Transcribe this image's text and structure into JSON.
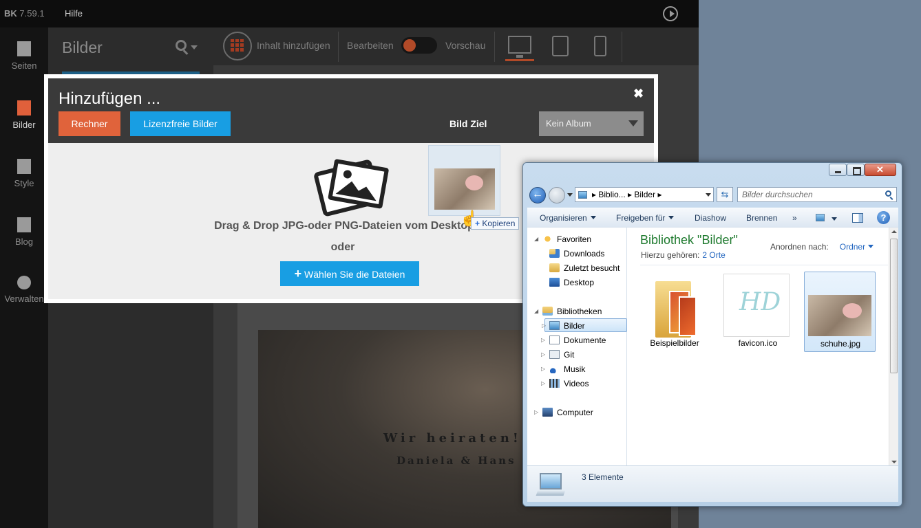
{
  "app": {
    "topbar": {
      "version_prefix": "BK",
      "version": "7.59.1",
      "help": "Hilfe"
    },
    "nav": [
      {
        "label": "Seiten"
      },
      {
        "label": "Bilder"
      },
      {
        "label": "Style"
      },
      {
        "label": "Blog"
      },
      {
        "label": "Verwalten"
      }
    ],
    "panel_title": "Bilder",
    "toolbar": {
      "add_content": "Inhalt hinzufügen",
      "edit": "Bearbeiten",
      "preview": "Vorschau"
    },
    "canvas_text": {
      "line1": "Wir heiraten!",
      "line2": "Daniela & Hans"
    }
  },
  "modal": {
    "title": "Hinzufügen ...",
    "close": "✖",
    "btn_calculator": "Rechner",
    "btn_stock": "Lizenzfreie Bilder",
    "dest_label": "Bild Ziel",
    "album_select": "Kein Album",
    "dropzone_text": "Drag & Drop JPG-oder PNG-Dateien vom Desktop",
    "or": "oder",
    "choose_plus": "+",
    "choose_label": "Wählen Sie die Dateien",
    "colors": {
      "orange": "#e0633b",
      "blue": "#189ee3"
    }
  },
  "drag": {
    "tip_plus": "+",
    "tip_label": "Kopieren"
  },
  "explorer": {
    "address": [
      "Biblio...",
      "Bilder"
    ],
    "search_placeholder": "Bilder durchsuchen",
    "commands": [
      "Organisieren",
      "Freigeben für",
      "Diashow",
      "Brennen",
      "»"
    ],
    "help": "?",
    "tree": {
      "favorites": "Favoriten",
      "fav_items": [
        "Downloads",
        "Zuletzt besucht",
        "Desktop"
      ],
      "libraries": "Bibliotheken",
      "lib_items": [
        "Bilder",
        "Dokumente",
        "Git",
        "Musik",
        "Videos"
      ],
      "computer": "Computer"
    },
    "library_title": "Bibliothek \"Bilder\"",
    "library_sub_label": "Hierzu gehören:",
    "library_sub_link": "2 Orte",
    "arrange_label": "Anordnen nach:",
    "arrange_value": "Ordner",
    "files": [
      "Beispielbilder",
      "favicon.ico",
      "schuhe.jpg"
    ],
    "status": "3 Elemente"
  }
}
